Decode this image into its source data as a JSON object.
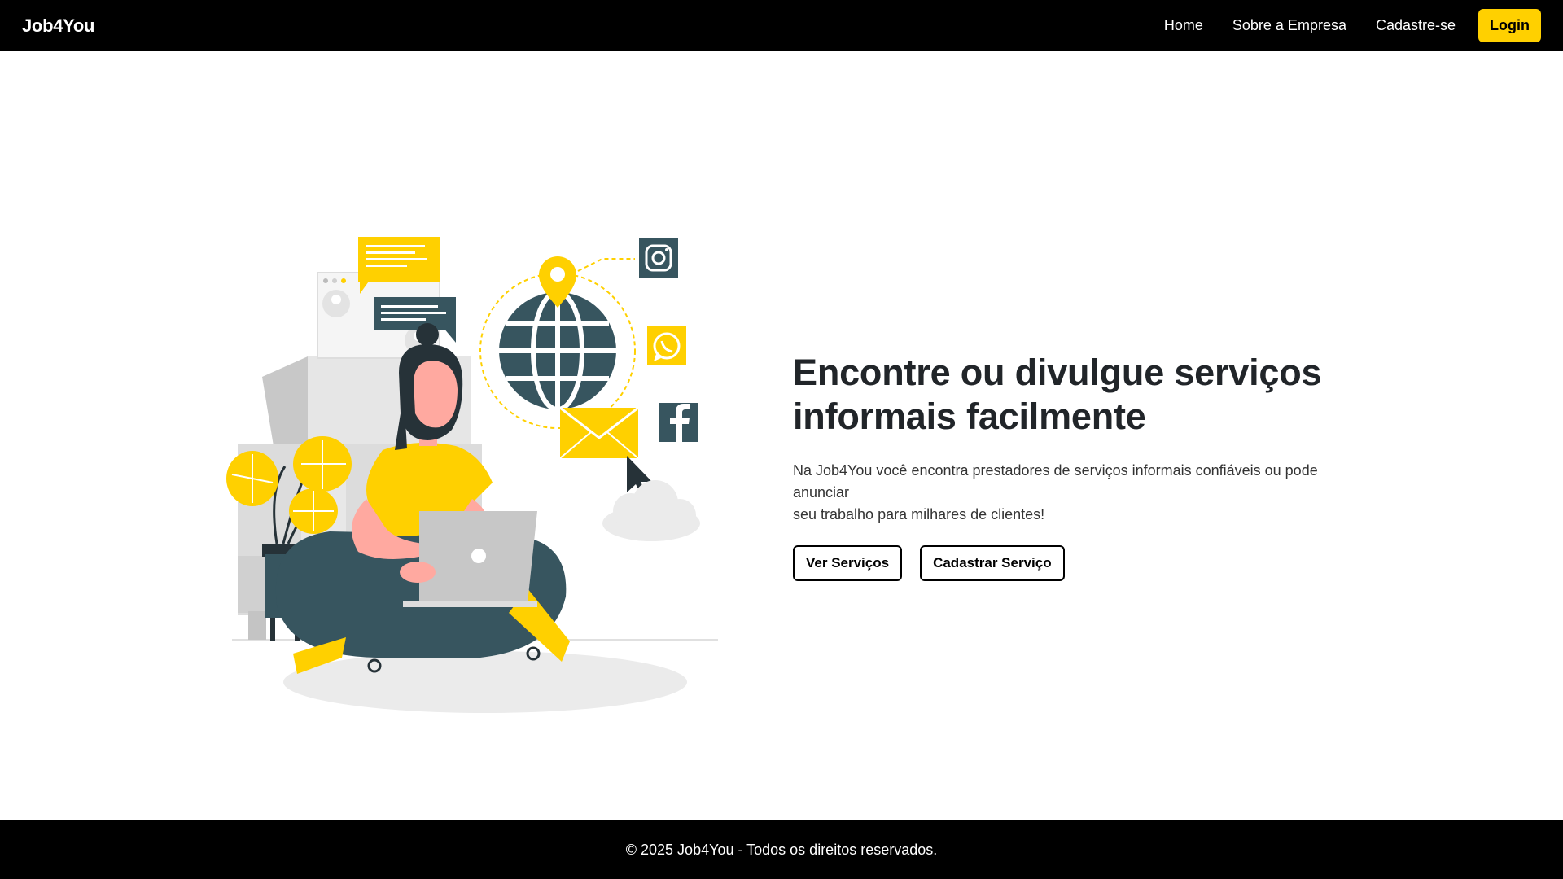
{
  "navbar": {
    "brand": "Job4You",
    "links": [
      "Home",
      "Sobre a Empresa",
      "Cadastre-se"
    ],
    "login_label": "Login"
  },
  "hero": {
    "title_line1": "Encontre ou divulgue serviços",
    "title_line2": "informais facilmente",
    "description_line1": "Na Job4You você encontra prestadores de serviços informais confiáveis ou pode anunciar",
    "description_line2": "seu trabalho para milhares de clientes!",
    "buttons": [
      "Ver Serviços",
      "Cadastrar Serviço"
    ]
  },
  "footer": {
    "text": "© 2025 Job4You - Todos os direitos reservados."
  },
  "colors": {
    "accent": "#ffd000",
    "dark": "#000000",
    "slate": "#37555f"
  }
}
